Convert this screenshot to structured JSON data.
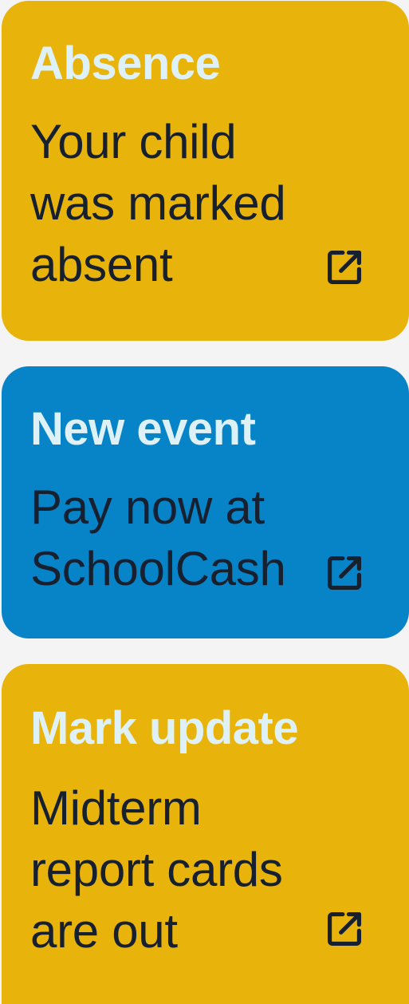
{
  "colors": {
    "page_background": "#f4f4f4",
    "title_text": "#def1f7",
    "body_text": "#16202e",
    "alert_accent": "#e8b30b",
    "event_accent": "#0783c7"
  },
  "notifications": [
    {
      "title": "Absence",
      "body_lines": [
        "Your child",
        "was marked",
        "absent"
      ],
      "color": "#e8b30b",
      "icon": "external-link-icon"
    },
    {
      "title": "New event",
      "body_lines": [
        "Pay now at",
        "SchoolCash"
      ],
      "color": "#0783c7",
      "icon": "external-link-icon"
    },
    {
      "title": "Mark update",
      "body_lines": [
        "Midterm",
        "report cards",
        "are out"
      ],
      "color": "#e8b30b",
      "icon": "external-link-icon"
    }
  ]
}
